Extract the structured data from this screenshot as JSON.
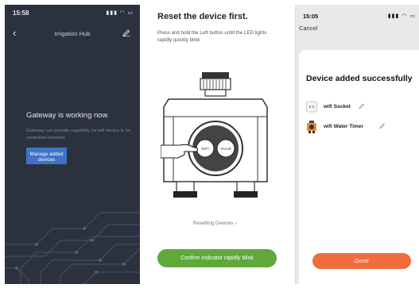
{
  "gateway_screen": {
    "status_time": "15:58",
    "status_icons": "▮▮▮ ◠ ▭",
    "title": "Irrigation Hub",
    "heading": "Gateway is working now",
    "description": "Gateway can provide capability for wifi device to be controlled remotely.",
    "manage_button": "Manage added devices"
  },
  "reset_screen": {
    "heading": "Reset the device first.",
    "description": "Press and hold the Left button untill the LED lights rapidly quickly blink",
    "device_labels": {
      "left": "WIFI",
      "right": "VALVE"
    },
    "resetting_link": "Resetting Devices ›",
    "confirm_button": "Confirm indicator rapidly blink"
  },
  "success_screen": {
    "status_time": "15:05",
    "status_icons": "▮▮▮ ◠ ▭",
    "cancel": "Cancel",
    "title": "Device added successfully",
    "devices": [
      {
        "name": "wifi Socket",
        "icon": "socket-icon"
      },
      {
        "name": "wifi Water Timer",
        "icon": "water-timer-icon"
      }
    ],
    "done_button": "Done"
  },
  "colors": {
    "dark_bg": "#2b313f",
    "blue_button": "#3d73c8",
    "green_button": "#5fa93b",
    "orange_button": "#f26d3d"
  }
}
